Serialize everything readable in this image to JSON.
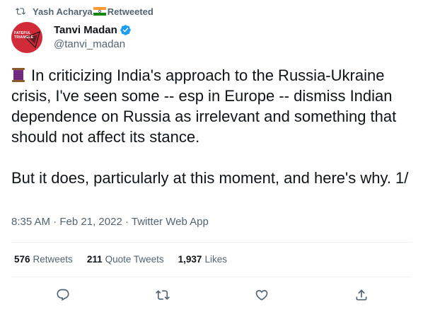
{
  "retweet_bar": {
    "icon": "retweet-icon",
    "retweeter_name": "Yash Acharya",
    "flag_icon": "india-flag-icon",
    "label": "Retweeted"
  },
  "author": {
    "avatar_text": "FATEFUL\nTRIANGLE",
    "display_name": "Tanvi Madan",
    "verified_icon": "verified-badge-icon",
    "handle": "@tanvi_madan"
  },
  "tweet": {
    "lead_emoji": "thread-spool-emoji",
    "text": "In criticizing India's approach to the Russia-Ukraine crisis, I've seen some -- esp in Europe -- dismiss Indian dependence on Russia as irrelevant and something that should not affect its stance.\n\nBut it does, particularly at this moment, and here's why. 1/"
  },
  "meta": {
    "time": "8:35 AM",
    "separator": "·",
    "date": "Feb 21, 2022",
    "source": "Twitter Web App"
  },
  "stats": {
    "retweets_count": "576",
    "retweets_label": "Retweets",
    "quotes_count": "211",
    "quotes_label": "Quote Tweets",
    "likes_count": "1,937",
    "likes_label": "Likes"
  },
  "actions": [
    {
      "name": "reply",
      "icon": "reply-icon"
    },
    {
      "name": "retweet",
      "icon": "retweet-icon"
    },
    {
      "name": "like",
      "icon": "heart-icon"
    },
    {
      "name": "share",
      "icon": "share-icon"
    }
  ],
  "colors": {
    "text_primary": "#0f1419",
    "text_secondary": "#536471",
    "verified_blue": "#1d9bf0",
    "avatar_red": "#d12b3a",
    "divider": "#eff3f4"
  }
}
